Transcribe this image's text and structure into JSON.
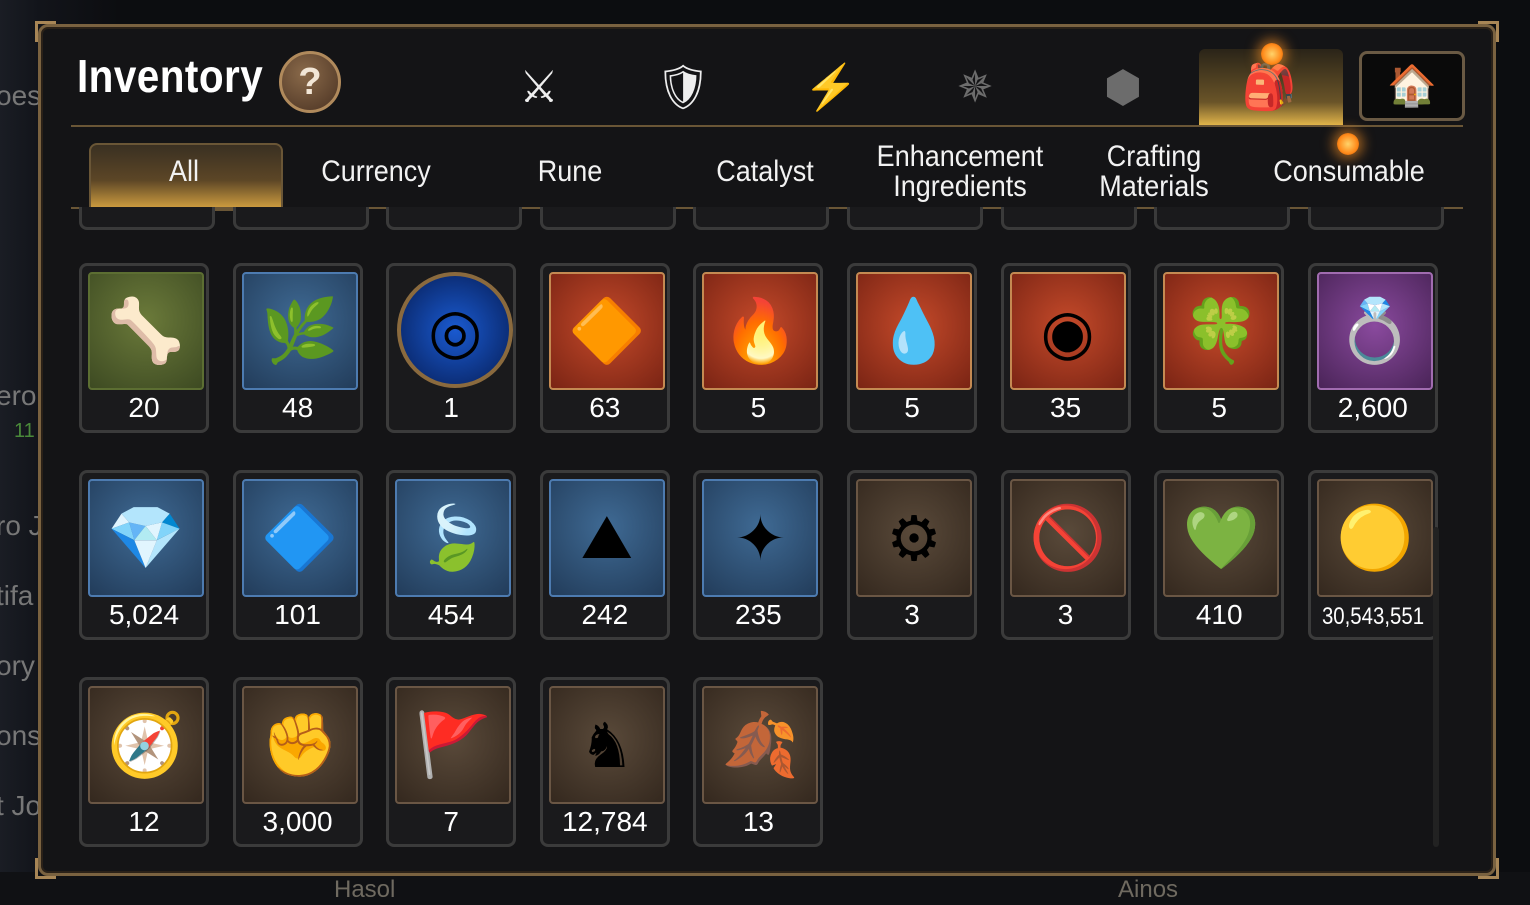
{
  "background": {
    "left_fragments": [
      "oes",
      "ero",
      "11",
      "ro J",
      "tifa",
      "ory",
      "ons",
      "t Jo"
    ],
    "bottom_labels": [
      "Hasol",
      "Ainos"
    ]
  },
  "header": {
    "title": "Inventory",
    "help_label": "?"
  },
  "category_tabs": [
    {
      "icon": "sword-shield-icon",
      "glyph": "⚔",
      "active": false
    },
    {
      "icon": "broken-shield-icon",
      "glyph": "🛡",
      "active": false
    },
    {
      "icon": "lightning-icon",
      "glyph": "⚡",
      "active": false
    },
    {
      "icon": "splash-burst-icon",
      "glyph": "✵",
      "active": false
    },
    {
      "icon": "cube-icon",
      "glyph": "⬢",
      "active": false
    },
    {
      "icon": "backpack-icon",
      "glyph": "🎒",
      "active": true
    },
    {
      "icon": "house-shield-icon",
      "glyph": "🏠",
      "active": false
    }
  ],
  "sub_tabs": [
    {
      "label": "All",
      "active": true
    },
    {
      "label": "Currency",
      "active": false
    },
    {
      "label": "Rune",
      "active": false
    },
    {
      "label": "Catalyst",
      "active": false
    },
    {
      "label": "Enhancement\nIngredients",
      "active": false
    },
    {
      "label": "Crafting\nMaterials",
      "active": false
    },
    {
      "label": "Consumable",
      "active": false
    }
  ],
  "items": [
    {
      "icon": "claw-icon",
      "glyph": "🦴",
      "bg": "green",
      "count": "20"
    },
    {
      "icon": "herb-icon",
      "glyph": "🌿",
      "bg": "blue",
      "count": "48"
    },
    {
      "icon": "rune-circle-icon",
      "glyph": "◎",
      "bg": "round",
      "count": "1"
    },
    {
      "icon": "fire-crystal-icon",
      "glyph": "🔶",
      "bg": "red",
      "count": "63"
    },
    {
      "icon": "flame-amulet-icon",
      "glyph": "🔥",
      "bg": "red",
      "count": "5"
    },
    {
      "icon": "water-amulet-icon",
      "glyph": "💧",
      "bg": "red",
      "count": "5"
    },
    {
      "icon": "wheel-amulet-icon",
      "glyph": "◉",
      "bg": "red",
      "count": "35"
    },
    {
      "icon": "clover-amulet-icon",
      "glyph": "🍀",
      "bg": "red",
      "count": "5"
    },
    {
      "icon": "ring-icon",
      "glyph": "💍",
      "bg": "purple",
      "count": "2,600"
    },
    {
      "icon": "blue-gem-icon",
      "glyph": "💎",
      "bg": "blue",
      "count": "5,024"
    },
    {
      "icon": "teal-crystal-icon",
      "glyph": "🔷",
      "bg": "blue",
      "count": "101"
    },
    {
      "icon": "leaf-icon",
      "glyph": "🍃",
      "bg": "blue",
      "count": "454"
    },
    {
      "icon": "pink-crystal-icon",
      "glyph": "⛰",
      "bg": "blue",
      "count": "242"
    },
    {
      "icon": "star-amulet-icon",
      "glyph": "✦",
      "bg": "blue",
      "count": "235"
    },
    {
      "icon": "capsule-icon",
      "glyph": "⚙",
      "bg": "brown",
      "count": "3"
    },
    {
      "icon": "no-battle-badge-icon",
      "glyph": "🚫",
      "bg": "brown",
      "count": "3"
    },
    {
      "icon": "green-heart-icon",
      "glyph": "💚",
      "bg": "brown",
      "count": "410"
    },
    {
      "icon": "gold-coin-icon",
      "glyph": "🟡",
      "bg": "brown",
      "count": "30,543,551",
      "small": true
    },
    {
      "icon": "compass-stone-icon",
      "glyph": "🧭",
      "bg": "brown",
      "count": "12"
    },
    {
      "icon": "fist-badge-icon",
      "glyph": "✊",
      "bg": "brown",
      "count": "3,000"
    },
    {
      "icon": "war-banner-icon",
      "glyph": "🚩",
      "bg": "brown",
      "count": "7"
    },
    {
      "icon": "knight-chess-icon",
      "glyph": "♞",
      "bg": "brown",
      "count": "12,784"
    },
    {
      "icon": "red-leaf-icon",
      "glyph": "🍂",
      "bg": "brown",
      "count": "13"
    }
  ]
}
